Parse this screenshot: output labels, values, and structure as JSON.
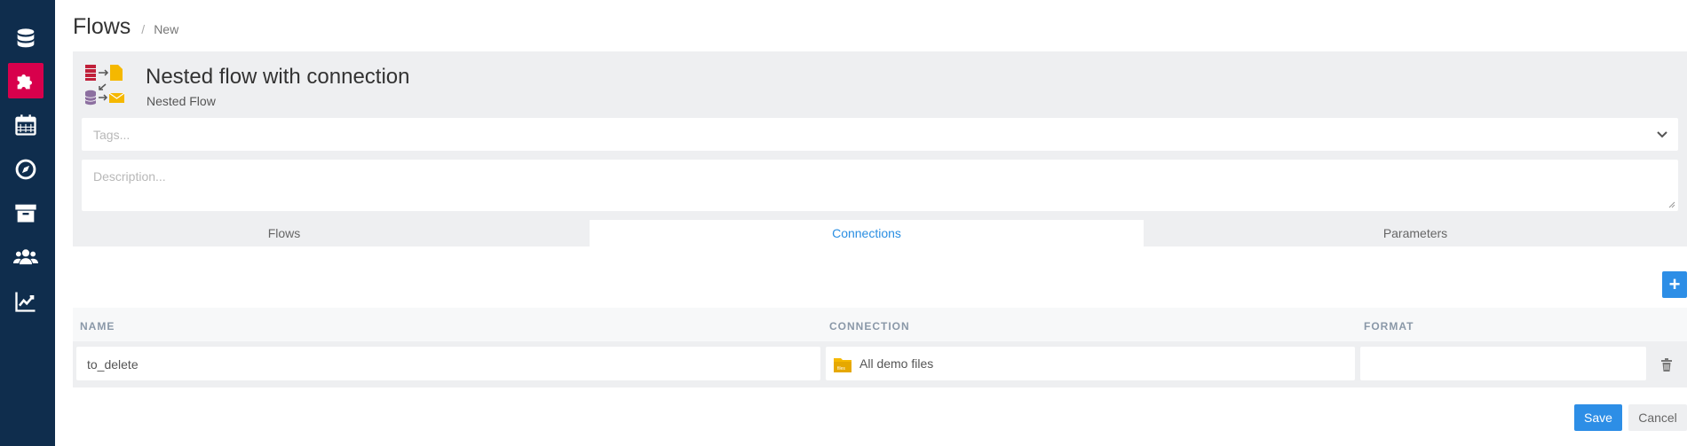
{
  "sidebar": {
    "items": [
      {
        "icon": "database-icon",
        "active": false
      },
      {
        "icon": "puzzle-icon",
        "active": true
      },
      {
        "icon": "calendar-icon",
        "active": false
      },
      {
        "icon": "compass-icon",
        "active": false
      },
      {
        "icon": "archive-icon",
        "active": false
      },
      {
        "icon": "users-icon",
        "active": false
      },
      {
        "icon": "chart-line-icon",
        "active": false
      }
    ],
    "background": "#0f2d4d",
    "active_color": "#d8004c"
  },
  "breadcrumb": {
    "title": "Flows",
    "separator": "/",
    "current": "New"
  },
  "flow": {
    "title": "Nested flow with connection",
    "subtitle": "Nested Flow",
    "icon": "nested-flow-icon"
  },
  "tags": {
    "placeholder": "Tags..."
  },
  "description": {
    "placeholder": "Description..."
  },
  "tabs": [
    {
      "label": "Flows",
      "active": false
    },
    {
      "label": "Connections",
      "active": true
    },
    {
      "label": "Parameters",
      "active": false
    }
  ],
  "table": {
    "columns": [
      "NAME",
      "CONNECTION",
      "FORMAT"
    ],
    "rows": [
      {
        "name": "to_delete",
        "connection": "All demo files",
        "connection_icon": "folder-icon",
        "format": ""
      }
    ]
  },
  "actions": {
    "add_label": "+",
    "save_label": "Save",
    "cancel_label": "Cancel"
  },
  "colors": {
    "accent": "#2d8ee6",
    "panel_bg": "#eeeff1"
  }
}
